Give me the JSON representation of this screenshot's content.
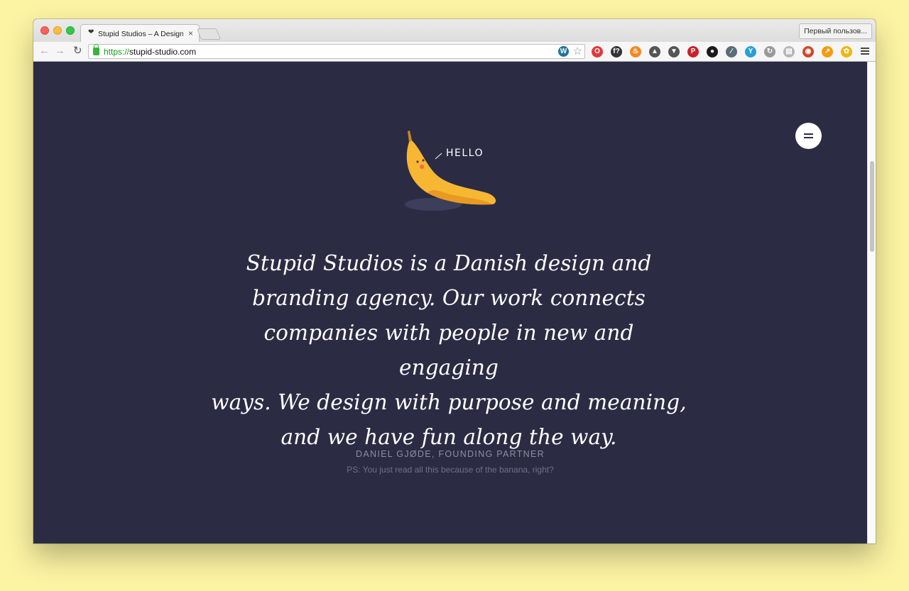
{
  "browser": {
    "tab_title": "Stupid Studios – A Design",
    "tab_close_glyph": "×",
    "tab_favicon": "❤",
    "profile_label": "Первый пользов...",
    "url_scheme": "https://",
    "url_host": "stupid-studio.com",
    "extensions": [
      {
        "name": "opera-icon",
        "color": "#e03a3a",
        "glyph": "O"
      },
      {
        "name": "font-finder-icon",
        "color": "#333333",
        "glyph": "f?"
      },
      {
        "name": "fire-icon",
        "color": "#f08a24",
        "glyph": "♨"
      },
      {
        "name": "evernote-icon",
        "color": "#555555",
        "glyph": "▲"
      },
      {
        "name": "pocket-icon",
        "color": "#555555",
        "glyph": "▼"
      },
      {
        "name": "pinterest-icon",
        "color": "#cb2027",
        "glyph": "P"
      },
      {
        "name": "colorpicker-icon",
        "color": "#1b1b1b",
        "glyph": "●"
      },
      {
        "name": "eyedropper-icon",
        "color": "#5a6b7a",
        "glyph": "∕"
      },
      {
        "name": "y-icon",
        "color": "#2aa0d8",
        "glyph": "Y"
      },
      {
        "name": "refresh-ext-icon",
        "color": "#9a9a9a",
        "glyph": "↻"
      },
      {
        "name": "reader-icon",
        "color": "#b5b5b5",
        "glyph": "▤"
      },
      {
        "name": "eye-icon",
        "color": "#d24726",
        "glyph": "◉"
      },
      {
        "name": "analytics-icon",
        "color": "#f39c12",
        "glyph": "↗"
      },
      {
        "name": "flower-icon",
        "color": "#f5b400",
        "glyph": "✿"
      }
    ]
  },
  "page": {
    "banana_caption": "HELLO",
    "quote_lines": [
      "Stupid Studios is a Danish design and",
      "branding agency. Our work connects",
      "companies with people in new and engaging",
      "ways. We design with purpose and meaning,",
      "and we have fun along the way."
    ],
    "author": "DANIEL GJØDE, FOUNDING PARTNER",
    "ps": "PS: You just read all this because of the banana, right?",
    "colors": {
      "background": "#2b2c44",
      "banana": "#f7b733",
      "text": "#ffffff"
    }
  }
}
